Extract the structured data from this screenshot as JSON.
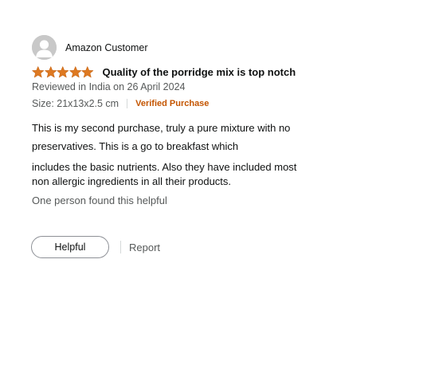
{
  "review": {
    "profile": {
      "name": "Amazon Customer",
      "avatar_icon": "default-user-avatar"
    },
    "rating": 5,
    "rating_max": 5,
    "star_color": "#de7921",
    "title": "Quality of the porridge mix is top notch",
    "date": "Reviewed in India on 26 April 2024",
    "format": "Size: 21x13x2.5 cm",
    "verified_label": "Verified Purchase",
    "verified_color": "#c45500",
    "body_lines": [
      "This is my second purchase, truly a pure mixture with no",
      "preservatives. This is a go to breakfast which",
      "includes the basic nutrients. Also they have included most",
      "non allergic ingredients in all their products."
    ],
    "helpful_count_text": "One person found this helpful",
    "helpful_button": "Helpful",
    "report_link": "Report"
  }
}
